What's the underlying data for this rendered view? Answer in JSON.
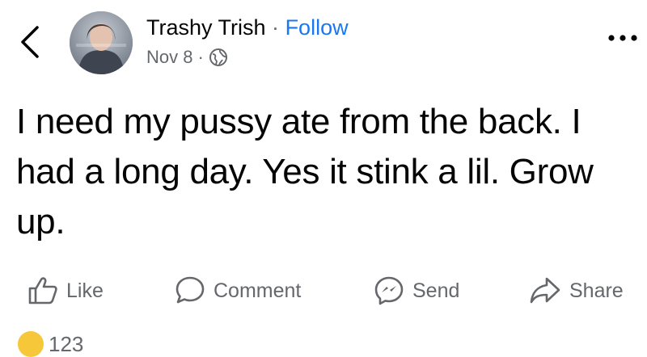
{
  "post": {
    "author": "Trashy Trish",
    "separator": "·",
    "follow_label": "Follow",
    "date": "Nov 8",
    "meta_separator": "·",
    "visibility_icon": "globe-icon",
    "text": "I need my pussy ate from the back. I had a long day. Yes it stink a lil. Grow up."
  },
  "actions": {
    "like": "Like",
    "comment": "Comment",
    "send": "Send",
    "share": "Share"
  },
  "reactions": {
    "count": "123"
  },
  "colors": {
    "link": "#1877f2",
    "secondary_text": "#65676b",
    "primary_text": "#050505"
  }
}
